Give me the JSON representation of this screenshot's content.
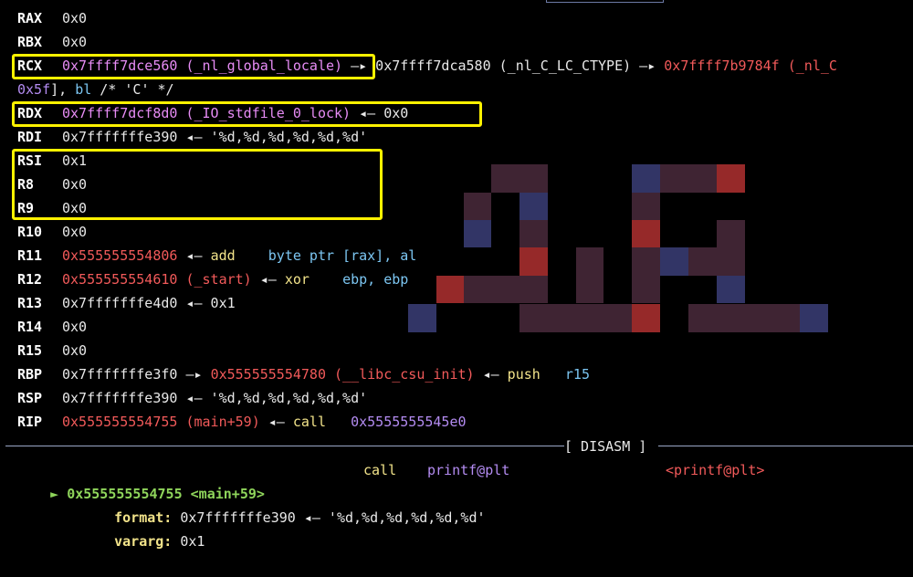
{
  "registers": [
    {
      "name": "RAX",
      "parts": [
        {
          "t": "0x0",
          "c": "w"
        }
      ]
    },
    {
      "name": "RBX",
      "parts": [
        {
          "t": "0x0",
          "c": "w"
        }
      ]
    },
    {
      "name": "RCX",
      "parts": [
        {
          "t": "0x7ffff7dce560 (_nl_global_locale)",
          "c": "mag"
        },
        {
          "t": " —▸ ",
          "c": "w"
        },
        {
          "t": "0x7ffff7dca580 (_nl_C_LC_CTYPE)",
          "c": "w"
        },
        {
          "t": " —▸ ",
          "c": "w"
        },
        {
          "t": "0x7ffff7b9784f (_nl_C",
          "c": "red"
        }
      ]
    },
    {
      "name": "",
      "parts": [
        {
          "t": "0x5f",
          "c": "pur"
        },
        {
          "t": "], ",
          "c": "w"
        },
        {
          "t": "bl",
          "c": "blu"
        },
        {
          "t": " /* 'C' */",
          "c": "w"
        }
      ]
    },
    {
      "name": "RDX",
      "parts": [
        {
          "t": "0x7ffff7dcf8d0 (_IO_stdfile_0_lock)",
          "c": "mag"
        },
        {
          "t": " ◂— 0x0",
          "c": "w"
        }
      ]
    },
    {
      "name": "RDI",
      "parts": [
        {
          "t": "0x7fffffffe390",
          "c": "w"
        },
        {
          "t": " ◂— '%d,%d,%d,%d,%d,%d'",
          "c": "w"
        }
      ]
    },
    {
      "name": "RSI",
      "parts": [
        {
          "t": "0x1",
          "c": "w"
        }
      ]
    },
    {
      "name": "R8",
      "parts": [
        {
          "t": "0x0",
          "c": "w"
        }
      ]
    },
    {
      "name": "R9",
      "parts": [
        {
          "t": "0x0",
          "c": "w"
        }
      ]
    },
    {
      "name": "R10",
      "parts": [
        {
          "t": "0x0",
          "c": "w"
        }
      ]
    },
    {
      "name": "R11",
      "parts": [
        {
          "t": "0x555555554806",
          "c": "red"
        },
        {
          "t": " ◂— ",
          "c": "w"
        },
        {
          "t": "add    ",
          "c": "yel"
        },
        {
          "t": "byte ptr [rax], al",
          "c": "blu"
        }
      ]
    },
    {
      "name": "R12",
      "parts": [
        {
          "t": "0x555555554610 (_start)",
          "c": "red"
        },
        {
          "t": " ◂— ",
          "c": "w"
        },
        {
          "t": "xor    ",
          "c": "yel"
        },
        {
          "t": "ebp, ebp",
          "c": "blu"
        }
      ]
    },
    {
      "name": "R13",
      "parts": [
        {
          "t": "0x7fffffffe4d0",
          "c": "w"
        },
        {
          "t": " ◂— 0x1",
          "c": "w"
        }
      ]
    },
    {
      "name": "R14",
      "parts": [
        {
          "t": "0x0",
          "c": "w"
        }
      ]
    },
    {
      "name": "R15",
      "parts": [
        {
          "t": "0x0",
          "c": "w"
        }
      ]
    },
    {
      "name": "RBP",
      "parts": [
        {
          "t": "0x7fffffffe3f0",
          "c": "w"
        },
        {
          "t": " —▸ ",
          "c": "w"
        },
        {
          "t": "0x555555554780 (__libc_csu_init)",
          "c": "red"
        },
        {
          "t": " ◂— ",
          "c": "w"
        },
        {
          "t": "push   ",
          "c": "yel"
        },
        {
          "t": "r15",
          "c": "blu"
        }
      ]
    },
    {
      "name": "RSP",
      "parts": [
        {
          "t": "0x7fffffffe390",
          "c": "w"
        },
        {
          "t": " ◂— '%d,%d,%d,%d,%d,%d'",
          "c": "w"
        }
      ]
    },
    {
      "name": "RIP",
      "parts": [
        {
          "t": "0x555555554755 (main+59)",
          "c": "red"
        },
        {
          "t": " ◂— ",
          "c": "w"
        },
        {
          "t": "call   ",
          "c": "yel"
        },
        {
          "t": "0x5555555545e0",
          "c": "pur"
        }
      ]
    }
  ],
  "disasm": {
    "header": "[ DISASM ]",
    "current": {
      "marker": "►",
      "address": "0x555555554755",
      "symbol": "<main+59>",
      "mnemonic": "call",
      "operand": "printf@plt",
      "target": "<printf@plt>"
    },
    "args": [
      {
        "label": "format:",
        "value": "0x7fffffffe390 ◂— '%d,%d,%d,%d,%d,%d'"
      },
      {
        "label": "vararg:",
        "value": "0x1"
      }
    ]
  },
  "colors": {
    "highlight_box": "#fff200",
    "pixel_dark": "#4a2a3c",
    "pixel_red": "#b03030",
    "pixel_blue": "#3b3e78"
  }
}
